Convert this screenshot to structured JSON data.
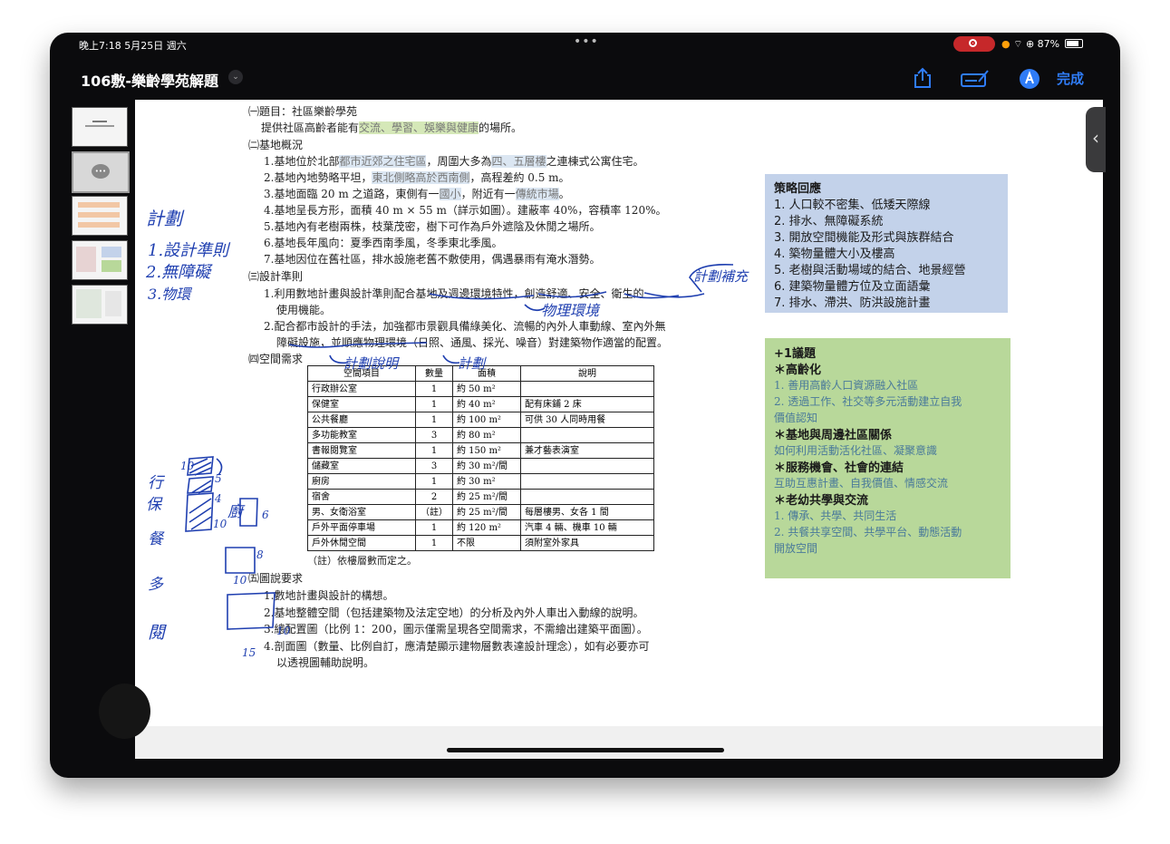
{
  "status": {
    "time_date": "晚上7:18   5月25日 週六",
    "dots": "•••",
    "battery": "87%"
  },
  "nav": {
    "title": "106敷-樂齡學苑解題",
    "done": "完成"
  },
  "thumbs": [
    {
      "id": 1
    },
    {
      "id": 2
    },
    {
      "id": 3
    },
    {
      "id": 4
    },
    {
      "id": 5
    }
  ],
  "doc": {
    "l1": "㈠題目：社區樂齡學苑",
    "l2a": "提供社區高齡者能有",
    "l2b": "交流、學習、娛樂與健康",
    "l2c": "的場所。",
    "l3": "㈡基地概況",
    "l4a": "1.基地位於北部",
    "l4b": "都市近郊之住宅區",
    "l4c": "，周圍大多為",
    "l4d": "四、五層樓",
    "l4e": "之連棟式公寓住宅。",
    "l5a": "2.基地內地勢略平坦，",
    "l5b": "東北側略高於西南側",
    "l5c": "，高程差約 0.5 m。",
    "l6a": "3.基地面臨 20 m 之道路，東側有一",
    "l6b": "國小",
    "l6c": "，附近有一",
    "l6d": "傳統市場",
    "l6e": "。",
    "l7": "4.基地呈長方形，面積 40 m × 55 m（詳示如圖）。建蔽率 40%，容積率 120%。",
    "l8": "5.基地內有老樹兩株，枝葉茂密，樹下可作為戶外遮陰及休閒之場所。",
    "l9": "6.基地長年風向：夏季西南季風，冬季東北季風。",
    "l10": "7.基地因位在舊社區，排水設施老舊不敷使用，偶遇暴雨有淹水潛勢。",
    "l11": "㈢設計準則",
    "l12": "1.利用數地計畫與設計準則配合基地及週邊環境特性，創造舒適、安全、衛生的",
    "l13": "使用機能。",
    "l14": "2.配合都市設計的手法，加強都市景觀具備綠美化、流暢的內外人車動線、室內外無",
    "l15": "障礙設施，並順應物理環境（日照、通風、採光、噪音）對建築物作適當的配置。",
    "l16": "㈣空間需求",
    "note": "（註）依樓層數而定之。",
    "l17": "㈤圖說要求",
    "l18": "1.數地計畫與設計的構想。",
    "l19": "2.基地整體空間（包括建築物及法定空地）的分析及內外人車出入動線的說明。",
    "l20": "3.總配置圖（比例 1：200，圖示僅需呈現各空間需求，不需繪出建築平面圖）。",
    "l21": "4.剖面圖（數量、比例自訂，應清楚顯示建物層數表達設計理念），如有必要亦可",
    "l22": "以透視圖輔助說明。"
  },
  "table": {
    "headers": [
      "空間項目",
      "數量",
      "面積",
      "說明"
    ],
    "rows": [
      [
        "行政辦公室",
        "1",
        "約 50 m²",
        ""
      ],
      [
        "保健室",
        "1",
        "約 40 m²",
        "配有床鋪 2 床"
      ],
      [
        "公共餐廳",
        "1",
        "約 100 m²",
        "可供 30 人同時用餐"
      ],
      [
        "多功能教室",
        "3",
        "約 80 m²",
        ""
      ],
      [
        "書報閱覽室",
        "1",
        "約 150 m²",
        "兼才藝表演室"
      ],
      [
        "儲藏室",
        "3",
        "約 30 m²/間",
        ""
      ],
      [
        "廚房",
        "1",
        "約 30 m²",
        ""
      ],
      [
        "宿舍",
        "2",
        "約 25 m²/間",
        ""
      ],
      [
        "男、女衛浴室",
        "（註）",
        "約 25 m²/間",
        "每層樓男、女各 1 間"
      ],
      [
        "戶外平面停車場",
        "1",
        "約 120 m²",
        "汽車 4 輛、機車 10 輛"
      ],
      [
        "戶外休閒空間",
        "1",
        "不限",
        "須附室外家具"
      ]
    ]
  },
  "strategy": {
    "title": "策略回應",
    "items": [
      "1.  人口較不密集、低矮天際線",
      "2.  排水、無障礙系統",
      "3.  開放空間機能及形式與族群結合",
      "4.  築物量體大小及樓高",
      "5.  老樹與活動場域的結合、地景經營",
      "6.  建築物量體方位及立面語彙",
      "7.  排水、滯洪、防洪設施計畫"
    ]
  },
  "issues": {
    "title": "+1議題",
    "s1": "＊高齡化",
    "s1a": "1. 善用高齡人口資源融入社區",
    "s1b": "2. 透過工作、社交等多元活動建立自我",
    "s1c": "價值認知",
    "s2": "＊基地與周邊社區關係",
    "s2a": "如何利用活動活化社區、凝聚意識",
    "s3": "＊服務機會、社會的連結",
    "s3a": "互助互惠計畫、自我價值、情感交流",
    "s4": "＊老幼共學與交流",
    "s4a": "1. 傳承、共學、共同生活",
    "s4b": "2. 共餐共享空間、共學平台、動態活動",
    "s4c": "開放空間"
  },
  "handwriting": {
    "h1": "計劃",
    "h2": "1.設計準則",
    "h3": "2.無障礙",
    "h4": "3.物環",
    "h5": "計劃補充",
    "h6": "物理環境",
    "h7": "計劃說明",
    "h8": "計劃",
    "s1": "行",
    "s2": "保",
    "s3": "餐",
    "s4": "多",
    "s5": "閱",
    "s6": "廚",
    "n1": "10",
    "n2": "5",
    "n3": "4",
    "n4": "10",
    "n5": "6",
    "n6": "8",
    "n7": "10",
    "n8": "10",
    "n9": "15"
  }
}
